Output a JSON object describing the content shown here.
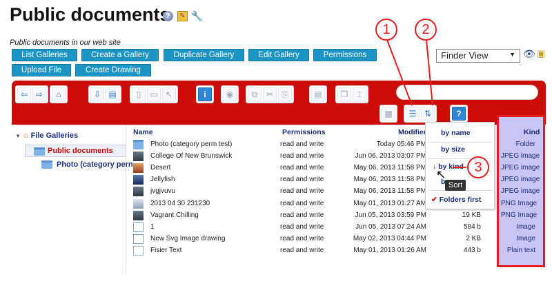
{
  "page": {
    "title": "Public documents",
    "subtitle": "Public documents in our web site"
  },
  "buttons": {
    "list_galleries": "List Galleries",
    "create_gallery": "Create a Gallery",
    "duplicate_gallery": "Duplicate Gallery",
    "edit_gallery": "Edit Gallery",
    "permissions": "Permissions",
    "upload_file": "Upload File",
    "create_drawing": "Create Drawing"
  },
  "view_select": {
    "selected": "Finder View"
  },
  "tree": {
    "root": "File Galleries",
    "selected": "Public documents",
    "child": "Photo (category pern"
  },
  "columns": {
    "name": "Name",
    "permissions": "Permissions",
    "modified": "Modified",
    "kind": "Kind"
  },
  "files": [
    {
      "name": "Photo (category perm test)",
      "perm": "read and write",
      "modified": "Today 05:46 PM",
      "size": "",
      "kind": "Folder",
      "thumb": "folder"
    },
    {
      "name": "College Of New Brunswick",
      "perm": "read and write",
      "modified": "Jun 06, 2013 03:07 PM",
      "size": "",
      "kind": "JPEG image",
      "thumb": "photo"
    },
    {
      "name": "Desert",
      "perm": "read and write",
      "modified": "May 06, 2013 11:58 PM",
      "size": "",
      "kind": "JPEG image",
      "thumb": "desert"
    },
    {
      "name": "Jellyfish",
      "perm": "read and write",
      "modified": "May 06, 2013 11:58 PM",
      "size": "",
      "kind": "JPEG image",
      "thumb": "jelly"
    },
    {
      "name": "jvgjvuvu",
      "perm": "read and write",
      "modified": "May 06, 2013 11:58 PM",
      "size": "",
      "kind": "JPEG image",
      "thumb": "photo"
    },
    {
      "name": "2013 04 30 231230",
      "perm": "read and write",
      "modified": "May 01, 2013 01:27 AM",
      "size": "",
      "kind": "PNG Image",
      "thumb": "png"
    },
    {
      "name": "Vagrant Chilling",
      "perm": "read and write",
      "modified": "Jun 05, 2013 03:59 PM",
      "size": "19 KB",
      "kind": "PNG Image",
      "thumb": "photo"
    },
    {
      "name": "1",
      "perm": "read and write",
      "modified": "Jun 05, 2013 07:24 AM",
      "size": "584 b",
      "kind": "Image",
      "thumb": "img"
    },
    {
      "name": "New Svg Image drawing",
      "perm": "read and write",
      "modified": "May 02, 2013 04:44 PM",
      "size": "2 KB",
      "kind": "Image",
      "thumb": "img"
    },
    {
      "name": "Fisier Text",
      "perm": "read and write",
      "modified": "May 01, 2013 01:26 AM",
      "size": "443 b",
      "kind": "Plain text",
      "thumb": "text"
    }
  ],
  "sort_menu": {
    "by_name": "by name",
    "by_size": "by size",
    "by_kind": "by kind",
    "partial": "b",
    "folders_first": "Folders first",
    "tooltip": "Sort"
  },
  "callouts": [
    "1",
    "2",
    "3"
  ],
  "colors": {
    "toolbar_red": "#cc0b0b",
    "button_blue": "#1c95c4",
    "kind_highlight": "#c8c4f4",
    "callout_red": "#e51d1d"
  }
}
